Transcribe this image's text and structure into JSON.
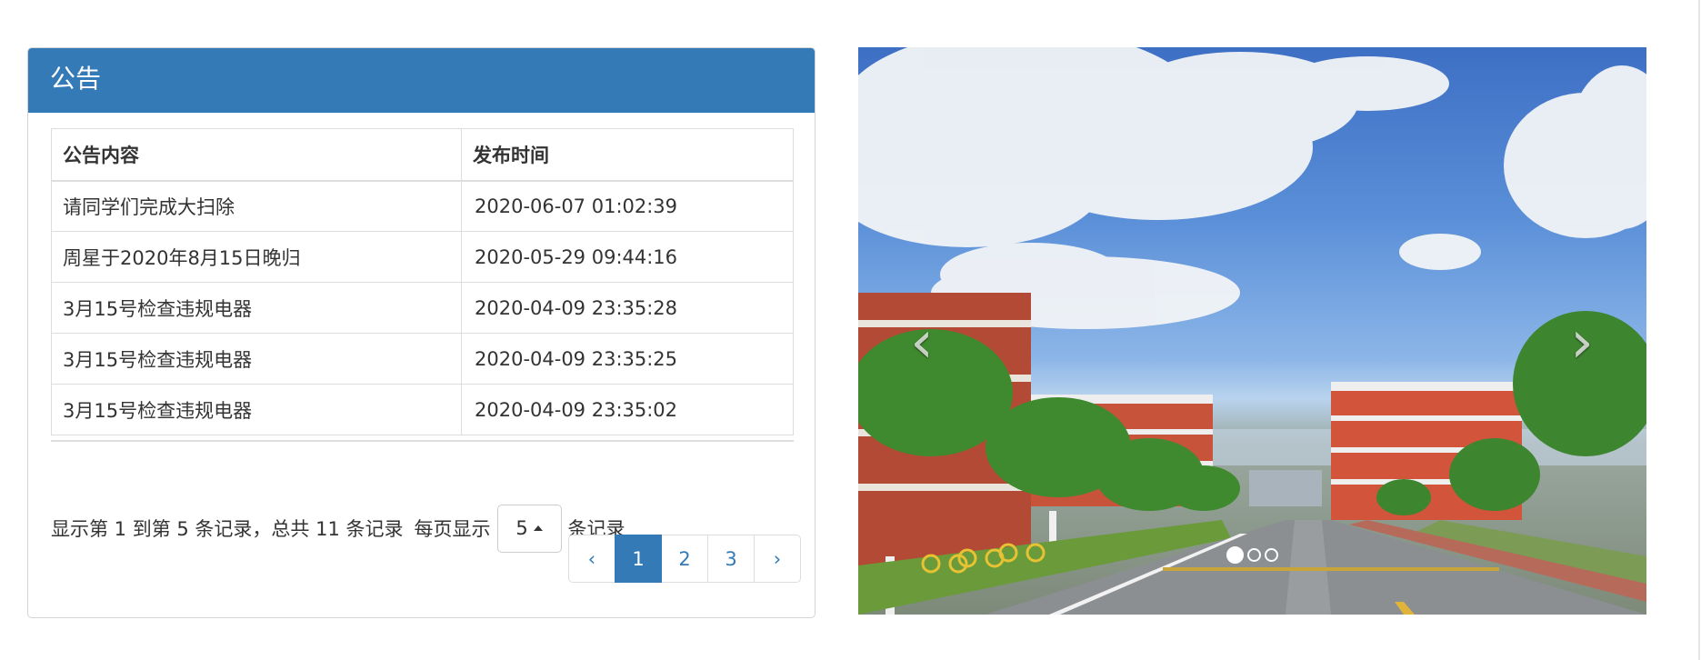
{
  "panel": {
    "title": "公告"
  },
  "table": {
    "headers": [
      "公告内容",
      "发布时间"
    ],
    "rows": [
      {
        "content": "请同学们完成大扫除",
        "time": "2020-06-07 01:02:39"
      },
      {
        "content": "周星于2020年8月15日晚归",
        "time": "2020-05-29 09:44:16"
      },
      {
        "content": "3月15号检查违规电器",
        "time": "2020-04-09 23:35:28"
      },
      {
        "content": "3月15号检查违规电器",
        "time": "2020-04-09 23:35:25"
      },
      {
        "content": "3月15号检查违规电器",
        "time": "2020-04-09 23:35:02"
      }
    ]
  },
  "pagination_info": {
    "summary": "显示第 1 到第 5 条记录，总共 11 条记录",
    "per_page_prefix": "每页显示",
    "page_size": "5",
    "per_page_suffix": "条记录"
  },
  "pagination": {
    "prev": "‹",
    "pages": [
      "1",
      "2",
      "3"
    ],
    "active_page": "1",
    "next": "›"
  },
  "carousel": {
    "prev_icon": "chevron-left-icon",
    "next_icon": "chevron-right-icon",
    "prev_glyph": "‹",
    "next_glyph": "›",
    "slide_count": 3,
    "active_index": 0
  },
  "colors": {
    "primary": "#337ab7",
    "border": "#dddddd"
  }
}
